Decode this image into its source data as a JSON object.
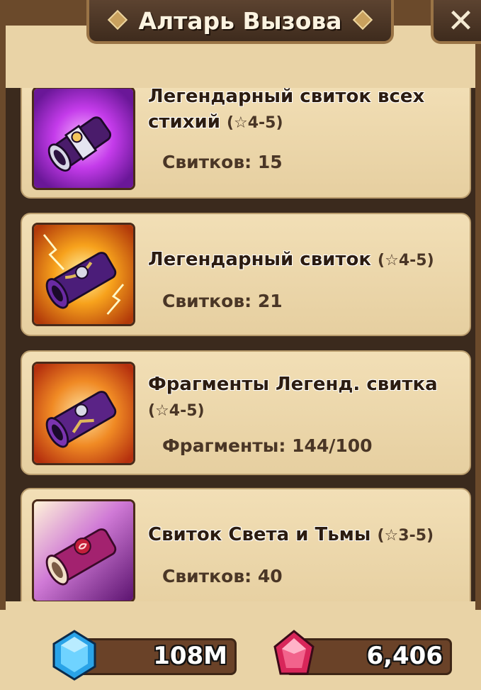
{
  "window": {
    "title": "Алтарь Вызова",
    "close_label": "✕"
  },
  "scrolls": [
    {
      "icon": "legendary-all-attribute-scroll-icon",
      "name_highlight": "Легендарный свиток всех стихий",
      "stars": "(☆4-5)",
      "count_label": "Свитков: 15"
    },
    {
      "icon": "legendary-scroll-icon",
      "name_highlight": "Легендарный свиток",
      "stars": "(☆4-5)",
      "count_label": "Свитков: 21"
    },
    {
      "icon": "legendary-scroll-fragments-icon",
      "name_highlight": "Фрагменты Легенд. свитка",
      "stars": "(☆4-5)",
      "count_label": "Фрагменты: 144/100"
    },
    {
      "icon": "light-and-dark-scroll-icon",
      "name_highlight": "Свиток Света и Тьмы",
      "stars": "(☆3-5)",
      "count_label": "Свитков: 40"
    }
  ],
  "resources": {
    "crystals": {
      "icon": "blue-crystal-icon",
      "value": "108M"
    },
    "rubies": {
      "icon": "red-crystal-icon",
      "value": "6,406"
    }
  },
  "colors": {
    "panel": "#e9d3a6",
    "frame": "#6b4a2b",
    "title_plate": "#4a3424",
    "card": "#efdbb0"
  }
}
